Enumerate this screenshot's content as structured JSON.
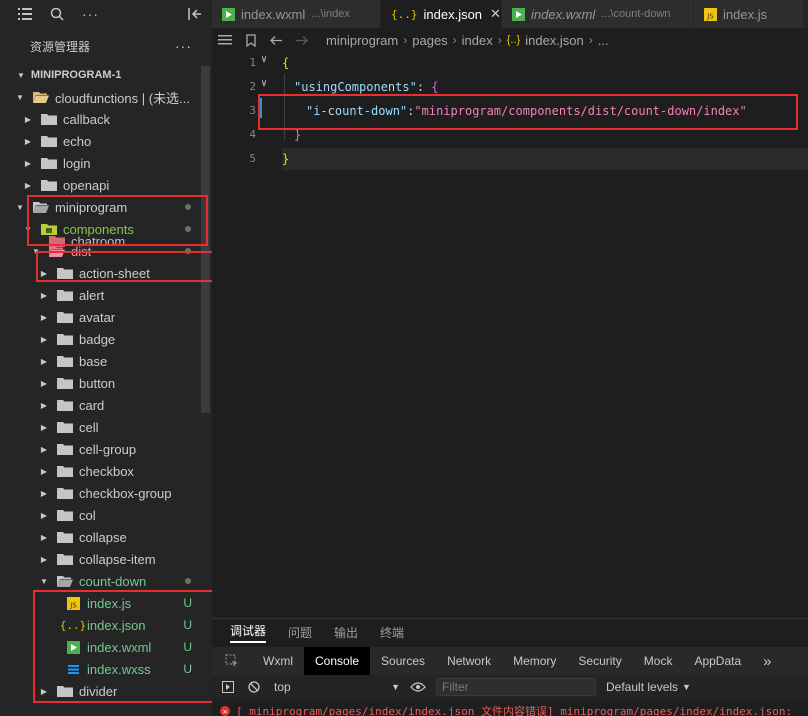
{
  "sidebar": {
    "title": "资源管理器",
    "more": "···",
    "root": "MINIPROGRAM-1",
    "items": [
      {
        "label": "cloudfunctions | (未选...",
        "kind": "folder-open-special",
        "arrow": "▼"
      },
      {
        "label": "callback",
        "kind": "folder",
        "arrow": "▶"
      },
      {
        "label": "echo",
        "kind": "folder",
        "arrow": "▶"
      },
      {
        "label": "login",
        "kind": "folder",
        "arrow": "▶"
      },
      {
        "label": "openapi",
        "kind": "folder",
        "arrow": "▶"
      },
      {
        "label": "miniprogram",
        "kind": "folder-open",
        "arrow": "▼"
      },
      {
        "label": "components",
        "kind": "folder-components",
        "arrow": "▼"
      },
      {
        "label": "chatroom",
        "kind": "folder-pink",
        "arrow": ""
      },
      {
        "label": "dist",
        "kind": "folder-pink-open",
        "arrow": "▼"
      },
      {
        "label": "action-sheet",
        "kind": "folder",
        "arrow": "▶"
      },
      {
        "label": "alert",
        "kind": "folder",
        "arrow": "▶"
      },
      {
        "label": "avatar",
        "kind": "folder",
        "arrow": "▶"
      },
      {
        "label": "badge",
        "kind": "folder",
        "arrow": "▶"
      },
      {
        "label": "base",
        "kind": "folder",
        "arrow": "▶"
      },
      {
        "label": "button",
        "kind": "folder",
        "arrow": "▶"
      },
      {
        "label": "card",
        "kind": "folder",
        "arrow": "▶"
      },
      {
        "label": "cell",
        "kind": "folder",
        "arrow": "▶"
      },
      {
        "label": "cell-group",
        "kind": "folder",
        "arrow": "▶"
      },
      {
        "label": "checkbox",
        "kind": "folder",
        "arrow": "▶"
      },
      {
        "label": "checkbox-group",
        "kind": "folder",
        "arrow": "▶"
      },
      {
        "label": "col",
        "kind": "folder",
        "arrow": "▶"
      },
      {
        "label": "collapse",
        "kind": "folder",
        "arrow": "▶"
      },
      {
        "label": "collapse-item",
        "kind": "folder",
        "arrow": "▶"
      },
      {
        "label": "count-down",
        "kind": "folder-open",
        "arrow": "▼"
      },
      {
        "label": "index.js",
        "kind": "file-js",
        "arrow": "",
        "badge": "U"
      },
      {
        "label": "index.json",
        "kind": "file-json",
        "arrow": "",
        "badge": "U"
      },
      {
        "label": "index.wxml",
        "kind": "file-wxml",
        "arrow": "",
        "badge": "U"
      },
      {
        "label": "index.wxss",
        "kind": "file-wxss",
        "arrow": "",
        "badge": "U"
      },
      {
        "label": "divider",
        "kind": "folder",
        "arrow": "▶"
      }
    ]
  },
  "tabs": [
    {
      "label": "index.wxml",
      "sub": "...\\index",
      "icon": "wxml-file-icon",
      "active": false,
      "italic": false
    },
    {
      "label": "index.json",
      "sub": "",
      "icon": "json-file-icon",
      "active": true,
      "italic": false,
      "close": "✕"
    },
    {
      "label": "index.wxml",
      "sub": "...\\count-down",
      "icon": "wxml-file-icon",
      "active": false,
      "italic": true
    },
    {
      "label": "index.js",
      "sub": "",
      "icon": "js-file-icon",
      "active": false,
      "italic": false
    }
  ],
  "breadcrumb": [
    "miniprogram",
    "pages",
    "index",
    "index.json",
    "..."
  ],
  "breadcrumb_json_icon": "{..}",
  "editor": {
    "line_numbers": [
      "1",
      "2",
      "3",
      "4",
      "5"
    ],
    "lines": {
      "l1": "{",
      "l2_key": "\"usingComponents\"",
      "l2_colon": ": ",
      "l2_brace": "{",
      "l3_key": "\"i-count-down\"",
      "l3_colon": ":",
      "l3_val": "\"miniprogram/components/dist/count-down/index\"",
      "l4": "}",
      "l5": "}"
    }
  },
  "devtools": {
    "top_tabs": [
      "调试器",
      "问题",
      "输出",
      "终端"
    ],
    "panels": [
      "Wxml",
      "Console",
      "Sources",
      "Network",
      "Memory",
      "Security",
      "Mock",
      "AppData"
    ],
    "more": "»",
    "context": "top",
    "filter_placeholder": "Filter",
    "levels": "Default levels",
    "error_text": "[ miniprogram/pages/index/index.json 文件内容错误] miniprogram/pages/index/index.json:"
  },
  "colors": {
    "highlight": "#e5302f",
    "accent_folder": "#dcb67a",
    "components_green": "#8bc34a",
    "untracked_badge": "#73c991"
  }
}
